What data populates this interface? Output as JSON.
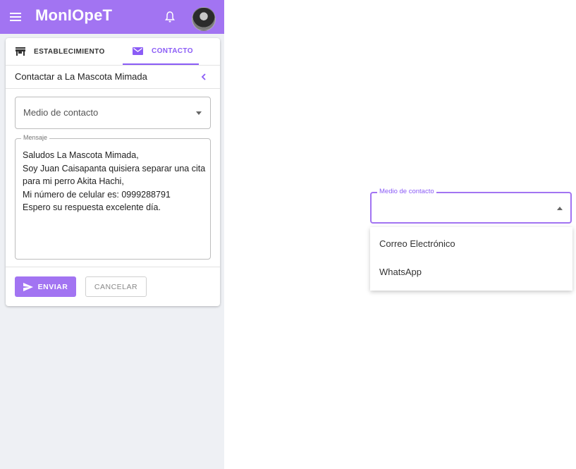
{
  "app": {
    "title": "MonIOpeT",
    "accent_color": "#a274f2",
    "icons": [
      "menu-icon",
      "bell-icon",
      "avatar",
      "store-icon",
      "mail-icon",
      "chevron-left-icon",
      "send-icon",
      "dropdown-arrow-icon"
    ]
  },
  "tabs": [
    {
      "label": "ESTABLECIMIENTO",
      "icon": "store-icon",
      "active": false
    },
    {
      "label": "CONTACTO",
      "icon": "mail-icon",
      "active": true
    }
  ],
  "contact": {
    "title": "Contactar a La Mascota Mimada",
    "select_placeholder": "Medio de contacto",
    "message_label": "Mensaje",
    "message_text": "Saludos La Mascota Mimada,\nSoy Juan Caisapanta quisiera separar una cita para mi perro Akita Hachi,\nMi número de celular es: 0999288791\nEspero su respuesta excelente día."
  },
  "actions": {
    "send_label": "ENVIAR",
    "cancel_label": "CANCELAR"
  },
  "dropdown": {
    "label": "Medio de contacto",
    "options": [
      "Correo Electrónico",
      "WhatsApp"
    ]
  }
}
